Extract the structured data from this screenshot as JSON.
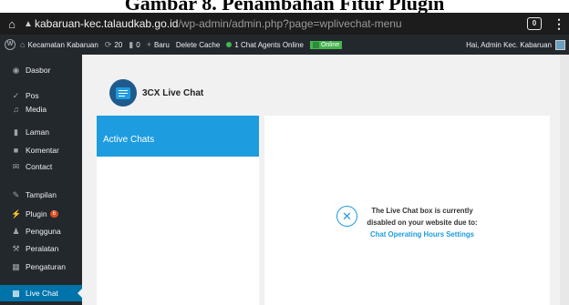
{
  "caption": {
    "text": "Gambar 8. Penambahan Fitur Plugin"
  },
  "browser": {
    "url_host": "kabaruan-kec.talaudkab.go.id",
    "url_path": "/wp-admin/admin.php?page=wplivechat-menu",
    "tabs_count": "0",
    "home_icon": "home-icon",
    "menu_icon": "kebab-menu-icon"
  },
  "adminbar": {
    "site_name": "Kecamatan Kabaruan",
    "updates": "20",
    "comments": "0",
    "new_label": "Baru",
    "delete_cache": "Delete Cache",
    "agents_online": "1 Chat Agents Online",
    "online_label": "Online",
    "greeting": "Hai, Admin Kec. Kabaruan"
  },
  "sidebar": {
    "items": [
      {
        "label": "Dasbor",
        "icon": "dashboard-icon"
      },
      {
        "label": "Pos",
        "icon": "pin-icon"
      },
      {
        "label": "Media",
        "icon": "media-icon"
      },
      {
        "label": "Laman",
        "icon": "page-icon"
      },
      {
        "label": "Komentar",
        "icon": "comment-icon"
      },
      {
        "label": "Contact",
        "icon": "mail-icon"
      },
      {
        "label": "Tampilan",
        "icon": "brush-icon"
      },
      {
        "label": "Plugin",
        "icon": "plugin-icon",
        "badge": "6"
      },
      {
        "label": "Pengguna",
        "icon": "user-icon"
      },
      {
        "label": "Peralatan",
        "icon": "wrench-icon"
      },
      {
        "label": "Pengaturan",
        "icon": "settings-icon"
      },
      {
        "label": "Live Chat",
        "icon": "chat-icon",
        "active": true
      }
    ]
  },
  "main": {
    "app_title": "3CX Live Chat",
    "active_chats": "Active Chats",
    "disabled_line1": "The Live Chat box is currently",
    "disabled_line2": "disabled on your website due to:",
    "settings_link": "Chat Operating Hours Settings"
  },
  "colors": {
    "admin_dark": "#23282d",
    "wp_blue": "#0073aa",
    "chat_blue": "#1d9ce0",
    "online_green": "#46b450"
  }
}
